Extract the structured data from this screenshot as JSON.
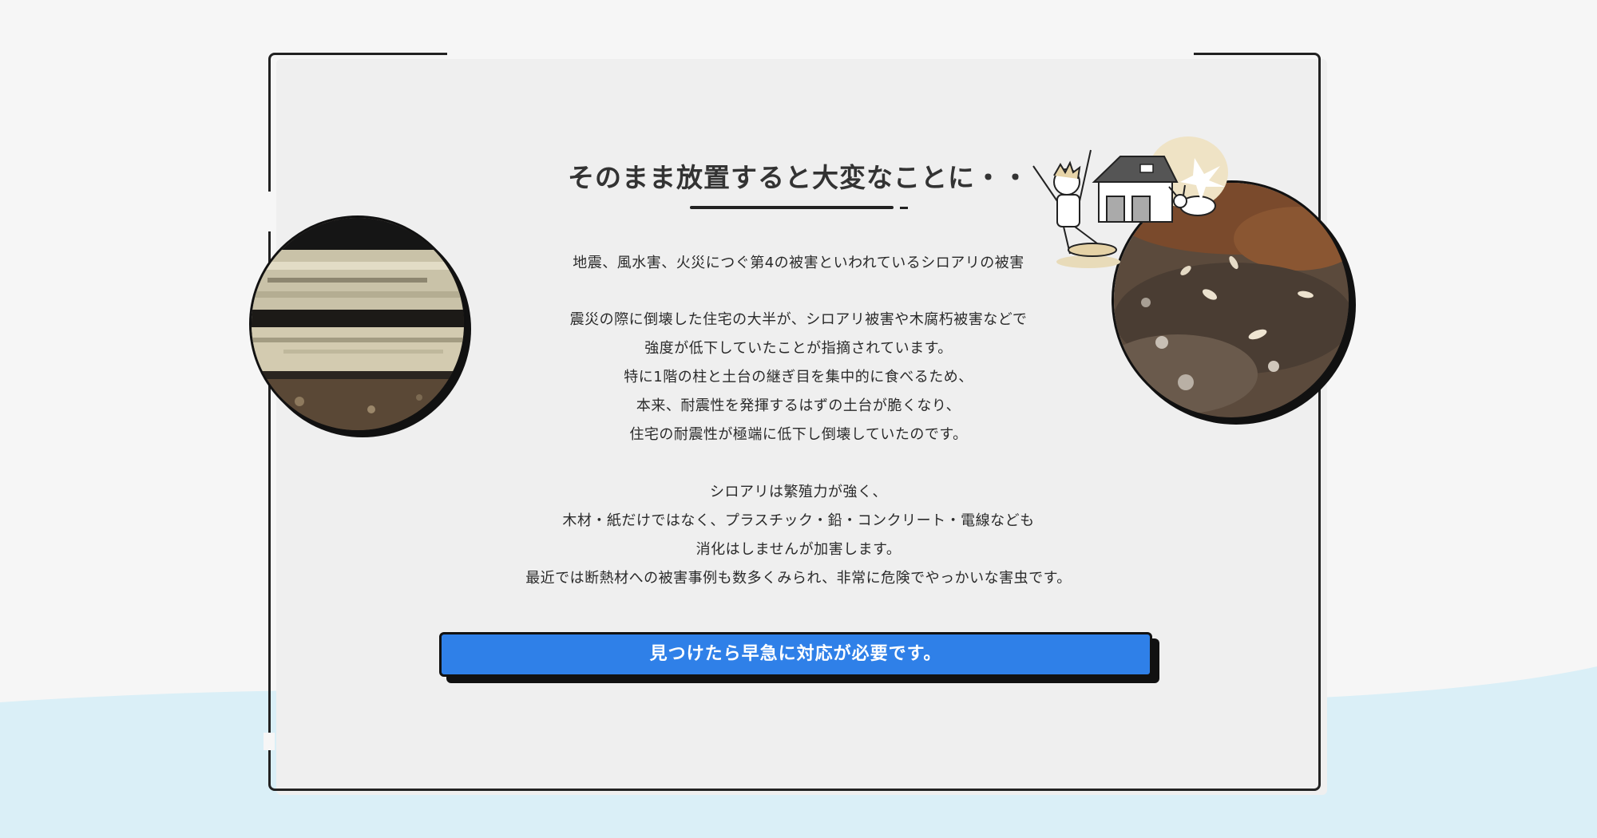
{
  "section": {
    "title": "そのまま放置すると大変なことに・・",
    "paragraph1": [
      "地震、風水害、火災につぐ第4の被害といわれているシロアリの被害"
    ],
    "paragraph2": [
      "震災の際に倒壊した住宅の大半が、シロアリ被害や木腐朽被害などで",
      "強度が低下していたことが指摘されています。",
      "特に1階の柱と土台の継ぎ目を集中的に食べるため、",
      "本来、耐震性を発揮するはずの土台が脆くなり、",
      "住宅の耐震性が極端に低下し倒壊していたのです。"
    ],
    "paragraph3": [
      "シロアリは繁殖力が強く、",
      "木材・紙だけではなく、プラスチック・鉛・コンクリート・電線なども",
      "消化はしませんが加害します。",
      "最近では断熱材への被害事例も数多くみられ、非常に危険でやっかいな害虫です。"
    ],
    "cta_label": "見つけたら早急に対応が必要です。"
  },
  "images": {
    "left_photo": "damaged-wood-photo",
    "right_photo": "termites-photo",
    "illustration": "surprised-person-house-termite-illustration"
  },
  "colors": {
    "background": "#f6f6f6",
    "card": "#efefef",
    "wave": "#daeff7",
    "cta": "#2f80e8",
    "border": "#222222",
    "text": "#2a2a2a"
  }
}
